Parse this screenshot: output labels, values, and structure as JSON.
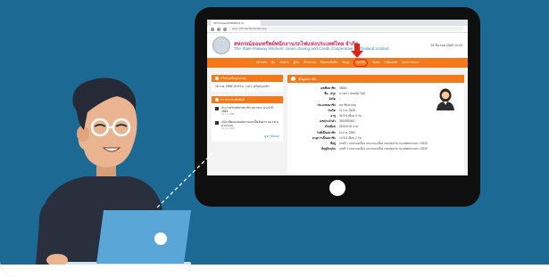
{
  "browser": {
    "tab_title": "สหกรณ์ออมทรัพย์พนักงาน...",
    "url": "srtsc.or.th/member/index.php"
  },
  "site": {
    "title_th": "สหกรณ์ออมทรัพย์พนักงานรถไฟแห่งประเทศไทย จำกัด",
    "title_en": "The State Railway Workers' Union Saving and Credit Cooperative of Thailand Limited",
    "date": "16 มีนาคม 2565 10:03"
  },
  "nav": {
    "items": [
      "หน้าหลัก",
      "หุ้น",
      "เงินฝาก",
      "กู้เงิน",
      "ค้ำประกัน",
      "ปันผลเฉลี่ยคืน",
      "ข้อมูล",
      "สมาชิก",
      "ติดต่อ",
      "เปลี่ยนรหัส",
      "ออกจากระบบ"
    ],
    "highlight_index": 7
  },
  "left_panel_1": {
    "title": "ปรับปรุงข้อมูลล่าสุด",
    "text": "16 ก.พ. 2565 10:03 น. เวลา: ปรับปรุงแล้ว"
  },
  "left_panel_2": {
    "title": "ข่าวประชาสัมพันธ์",
    "news": [
      {
        "text": "ประกาศรับสมัครสมาชิก สอ.รฟ.ท. ประจำปี 2565",
        "date": "14 ก.พ. 2565"
      },
      {
        "text": "แจ้งเปลี่ยนแปลงอัตราดอกเบี้ยเงินฝาก สอ.รฟ.ท. ผ่านระบบ",
        "date": "10 ก.พ. 2565"
      }
    ],
    "more": "ดูข่าวทั้งหมด"
  },
  "info": {
    "title": "ข้อมูลสมาชิก",
    "rows": [
      {
        "label": "เลขที่สมาชิก",
        "value": "05981"
      },
      {
        "label": "ชื่อ - สกุล",
        "value": "นางสาว สมหญิง ใจดี"
      },
      {
        "label": "สังกัด",
        "value": "-"
      },
      {
        "label": "ประเภทสมาชิก",
        "value": "สมาชิกสามัญ"
      },
      {
        "label": "วันเกิด",
        "value": "11 ก.ย. 2528"
      },
      {
        "label": "อายุ",
        "value": "36 ปี 6 เดือน 5 วัน"
      },
      {
        "label": "เลขประจำตัว",
        "value": "3920987667"
      },
      {
        "label": "เงินเดือน",
        "value": "28,000.00 บาท"
      },
      {
        "label": "วันที่เป็นสมาชิก",
        "value": "14 ก.ย. 2554"
      },
      {
        "label": "อายุการเป็นสมาชิก",
        "value": "10 ปี 6 เดือน 2 วัน"
      },
      {
        "label": "ที่อยู่",
        "value": "เลขที่ 1 ถนนรองเมือง แขวงรองเมือง เขตปทุมวัน กรุงเทพมหานคร 10330"
      },
      {
        "label": "ที่อยู่ปัจจุบัน",
        "value": "เลขที่ 1 ถนนรองเมือง แขวงรองเมือง เขตปทุมวัน กรุงเทพมหานคร 10330"
      }
    ]
  },
  "colors": {
    "background": "#1c6a93",
    "accent_orange": "#f07a1c",
    "arrow_red": "#e2231a",
    "tablet": "#0f0f10",
    "laptop": "#5aa6d6",
    "shirt": "#2a2f3d",
    "skin": "#e9b48f"
  },
  "icons": [
    "red-arrow-icon",
    "avatar-icon",
    "laptop-icon",
    "glasses-icon"
  ]
}
